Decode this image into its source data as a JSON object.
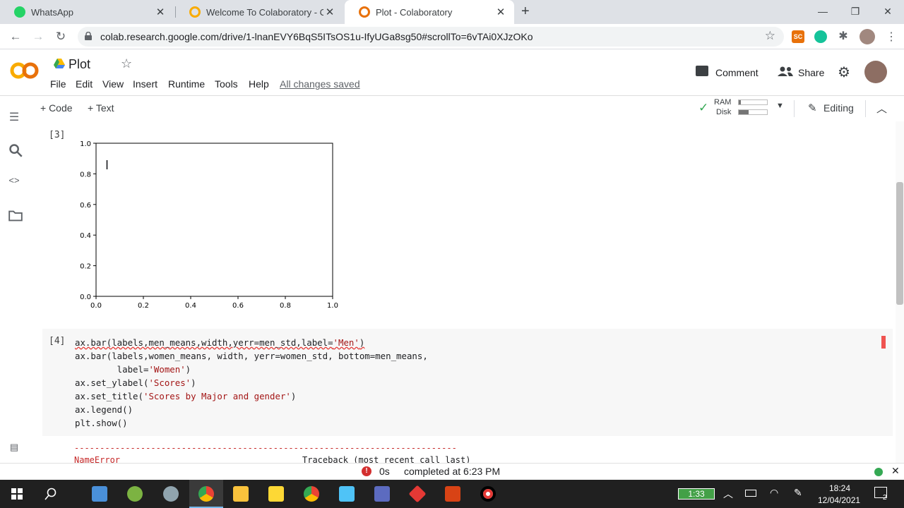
{
  "browser": {
    "tabs": [
      {
        "label": "WhatsApp",
        "active": false
      },
      {
        "label": "Welcome To Colaboratory - Colab",
        "active": false
      },
      {
        "label": "Plot - Colaboratory",
        "active": true
      }
    ],
    "url": "colab.research.google.com/drive/1-lnanEVY6BqS5ITsOS1u-IfyUGa8sg50#scrollTo=6vTAi0XJzOKo",
    "extension_badge": "SC"
  },
  "colab": {
    "logo": "CO",
    "title": "Plot",
    "menu": [
      "File",
      "Edit",
      "View",
      "Insert",
      "Runtime",
      "Tools",
      "Help"
    ],
    "saved_status": "All changes saved",
    "comment_label": "Comment",
    "share_label": "Share",
    "add_code": "+ Code",
    "add_text": "+ Text",
    "ram_label": "RAM",
    "disk_label": "Disk",
    "editing_label": "Editing"
  },
  "cells": {
    "output_exec": "[3]",
    "code_exec": "[4]",
    "code_lines": [
      [
        "ax.bar(labels,men_means,width,yerr=men_std,label=",
        "'Men'",
        ")"
      ],
      [
        "ax.bar(labels,women_means, width, yerr=women_std, bottom=men_means,",
        "",
        ""
      ],
      [
        "        label=",
        "'Women'",
        ")"
      ],
      [
        "ax.set_ylabel(",
        "'Scores'",
        ")"
      ],
      [
        "ax.set_title(",
        "'Scores by Major and gender'",
        ")"
      ],
      [
        "ax.legend()",
        "",
        ""
      ],
      [
        "plt.show()",
        "",
        ""
      ]
    ],
    "traceback_rule": "---------------------------------------------------------------------------",
    "error_name": "NameError",
    "traceback_label": "Traceback (most recent call last)"
  },
  "chart_data": {
    "type": "scatter",
    "title": "",
    "xlabel": "",
    "ylabel": "",
    "xlim": [
      0.0,
      1.0
    ],
    "ylim": [
      0.0,
      1.0
    ],
    "xticks": [
      "0.0",
      "0.2",
      "0.4",
      "0.6",
      "0.8",
      "1.0"
    ],
    "yticks": [
      "0.0",
      "0.2",
      "0.4",
      "0.6",
      "0.8",
      "1.0"
    ],
    "series": [],
    "grid": false
  },
  "status": {
    "duration": "0s",
    "completed": "completed at 6:23 PM"
  },
  "taskbar": {
    "battery_time": "1:33",
    "time": "18:24",
    "date": "12/04/2021",
    "notifications": "2"
  }
}
